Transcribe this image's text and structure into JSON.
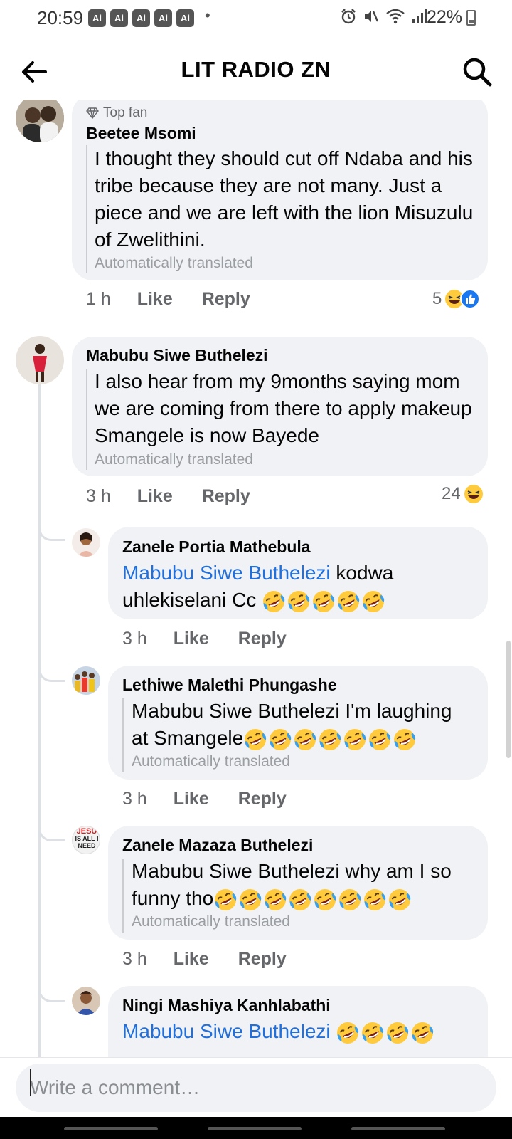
{
  "status_bar": {
    "time": "20:59",
    "ai_badges": [
      "Ai",
      "Ai",
      "Ai",
      "Ai",
      "Ai"
    ],
    "dot": "•",
    "battery": "22%"
  },
  "header": {
    "title": "LIT RADIO ZN"
  },
  "comments": [
    {
      "badge": "Top fan",
      "author": "Beetee Msomi",
      "text": "I thought they should cut off Ndaba and his tribe because they are not many. Just a piece and we are left with the lion Misuzulu of Zwelithini.",
      "translated": "Automatically translated",
      "time": "1 h",
      "like": "Like",
      "reply": "Reply",
      "reaction_count": "5"
    },
    {
      "author": "Mabubu Siwe Buthelezi",
      "text": "I also hear from my 9months saying mom we are coming from there to apply makeup Smangele is now Bayede",
      "translated": "Automatically translated",
      "time": "3 h",
      "like": "Like",
      "reply": "Reply",
      "reaction_count": "24"
    }
  ],
  "replies": [
    {
      "author": "Zanele Portia Mathebula",
      "mention": "Mabubu Siwe Buthelezi",
      "text": " kodwa uhlekiselani Cc",
      "emoji_count": 5,
      "time": "3 h",
      "like": "Like",
      "reply": "Reply"
    },
    {
      "author": "Lethiwe Malethi Phungashe",
      "text_line1": "Mabubu Siwe Buthelezi I'm laughing",
      "text_line2": "at Smangele",
      "emoji_count": 7,
      "translated": "Automatically translated",
      "time": "3 h",
      "like": "Like",
      "reply": "Reply"
    },
    {
      "author": "Zanele Mazaza Buthelezi",
      "text_line1": "Mabubu Siwe Buthelezi why am I so",
      "text_line2": "funny tho",
      "emoji_count": 8,
      "translated": "Automatically translated",
      "time": "3 h",
      "like": "Like",
      "reply": "Reply",
      "avatar_text": [
        "JESU",
        "IS ALL I",
        "NEED"
      ]
    },
    {
      "author": "Ningi Mashiya Kanhlabathi",
      "mention": "Mabubu Siwe Buthelezi",
      "emoji_count": 4
    }
  ],
  "composer": {
    "placeholder": "Write a comment…"
  },
  "colors": {
    "link": "#216fdb",
    "bubble": "#f0f2f5",
    "muted": "#65676b",
    "like_blue": "#1877f2",
    "emoji_yellow": "#ffcb3d"
  },
  "icons": [
    "back-arrow-icon",
    "search-icon",
    "diamond-icon",
    "laugh-emoji-icon",
    "like-thumb-icon",
    "cry-laugh-emoji-icon",
    "alarm-icon",
    "mute-icon",
    "wifi-icon",
    "signal-icon",
    "battery-icon"
  ]
}
